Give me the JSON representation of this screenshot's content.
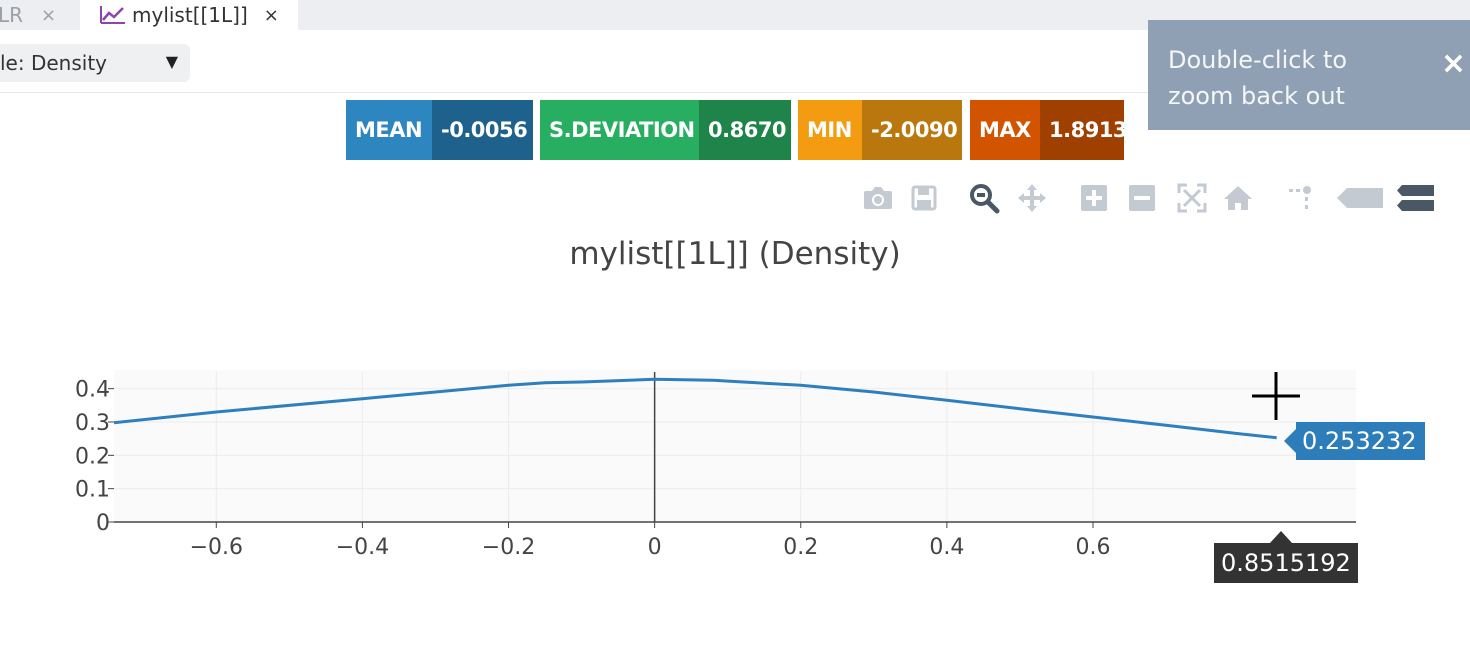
{
  "tabs": [
    {
      "label": "LR",
      "close": "×"
    },
    {
      "label": "mylist[[1L]]",
      "close": "×",
      "icon": "line-chart-icon"
    }
  ],
  "toolbar": {
    "chart_type_select": "le: Density",
    "caret": "▼"
  },
  "stats": {
    "mean": {
      "label": "MEAN",
      "value": "-0.0056",
      "color": "#2e86c1"
    },
    "sd": {
      "label": "S.DEVIATION",
      "value": "0.8670",
      "color": "#27ae60"
    },
    "min": {
      "label": "MIN",
      "value": "-2.0090",
      "color": "#f39c12"
    },
    "max": {
      "label": "MAX",
      "value": "1.8913",
      "color": "#d35400"
    }
  },
  "notifier": {
    "text": "Double-click to zoom back out",
    "close": "×"
  },
  "modebar": [
    "camera-icon",
    "save-icon",
    "zoom-icon",
    "pan-icon",
    "zoom-in-icon",
    "zoom-out-icon",
    "autoscale-icon",
    "reset-axes-icon",
    "spike-lines-icon",
    "hover-closest-icon",
    "hover-compare-icon"
  ],
  "hover": {
    "x_label": "0.8515192",
    "y_label": "0.253232"
  },
  "chart_data": {
    "type": "line",
    "title": "mylist[[1L]] (Density)",
    "xlabel": "",
    "ylabel": "",
    "xlim": [
      -0.74,
      0.96
    ],
    "ylim": [
      0,
      0.45
    ],
    "x_ticks": [
      "−0.6",
      "−0.4",
      "−0.2",
      "0",
      "0.2",
      "0.4",
      "0.6"
    ],
    "x_tick_values": [
      -0.6,
      -0.4,
      -0.2,
      0,
      0.2,
      0.4,
      0.6
    ],
    "y_ticks": [
      "0",
      "0.1",
      "0.2",
      "0.3",
      "0.4"
    ],
    "y_tick_values": [
      0,
      0.1,
      0.2,
      0.3,
      0.4
    ],
    "grid": true,
    "line_color": "#2e7fc0",
    "x": [
      -0.74,
      -0.6,
      -0.4,
      -0.3,
      -0.2,
      -0.15,
      -0.1,
      0,
      0.08,
      0.2,
      0.3,
      0.4,
      0.5,
      0.6,
      0.7,
      0.8,
      0.8515
    ],
    "y": [
      0.298,
      0.33,
      0.37,
      0.39,
      0.41,
      0.418,
      0.42,
      0.428,
      0.425,
      0.41,
      0.39,
      0.365,
      0.34,
      0.315,
      0.29,
      0.265,
      0.253
    ],
    "cursor_x": 0.8515
  }
}
